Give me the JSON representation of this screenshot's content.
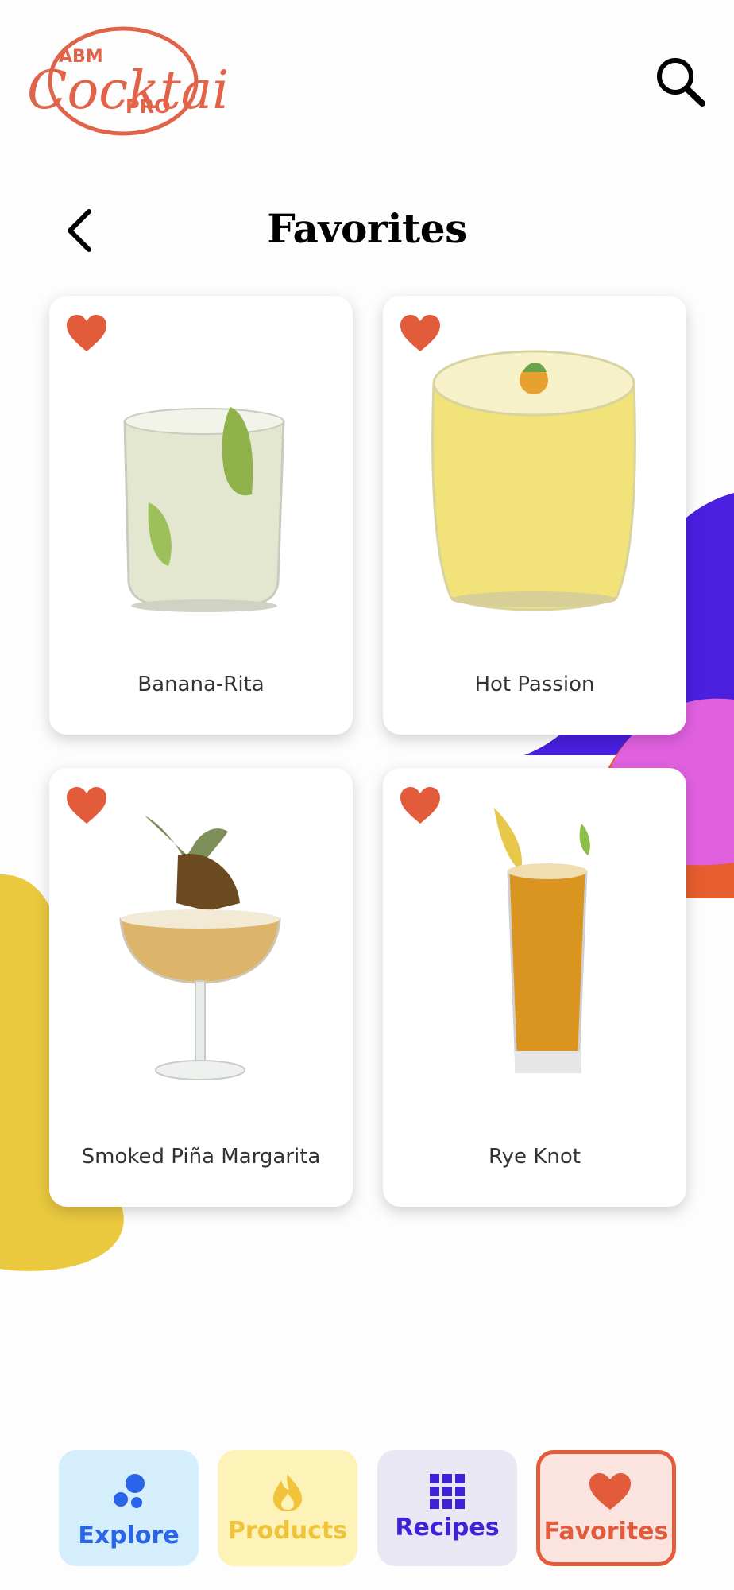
{
  "app": {
    "logo": {
      "line1": "ABM",
      "line2": "Cocktail",
      "line3": "PRO"
    }
  },
  "header": {
    "title": "Favorites"
  },
  "favorites": [
    {
      "name": "Banana-Rita"
    },
    {
      "name": "Hot Passion"
    },
    {
      "name": "Smoked Piña Margarita"
    },
    {
      "name": "Rye Knot"
    }
  ],
  "nav": {
    "tabs": [
      {
        "label": "Explore",
        "icon": "dots-icon"
      },
      {
        "label": "Products",
        "icon": "flame-icon"
      },
      {
        "label": "Recipes",
        "icon": "grid-icon"
      },
      {
        "label": "Favorites",
        "icon": "heart-icon"
      }
    ],
    "active": "Favorites"
  },
  "colors": {
    "accent": "#e25c3c",
    "explore_bg": "#d4eefb",
    "explore_fg": "#2a64e8",
    "products_bg": "#fdf3b8",
    "products_fg": "#f0c33a",
    "recipes_bg": "#eae7f4",
    "recipes_fg": "#3f22d8",
    "favorites_bg": "#fbe3df",
    "blob_yellow": "#eac93f",
    "blob_purple": "#4a1fe0",
    "blob_pink": "#e160e0",
    "blob_orange": "#e75d2f"
  }
}
